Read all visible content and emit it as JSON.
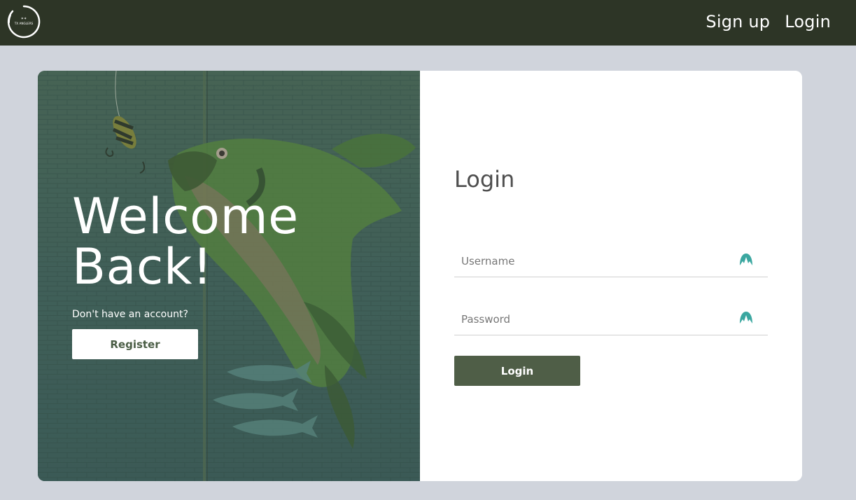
{
  "navbar": {
    "logo_icon": "anglers-logo-icon",
    "logo_text": "TX ANGLERS",
    "links": [
      {
        "label": "Sign up"
      },
      {
        "label": "Login"
      }
    ],
    "colors": {
      "background": "#2d3526",
      "text": "#ffffff"
    }
  },
  "hero": {
    "title_line1": "Welcome",
    "title_line2": "Back!",
    "subtitle": "Don't have an account?",
    "register_label": "Register",
    "background_icon": "fish-mural-image"
  },
  "form": {
    "title": "Login",
    "username": {
      "placeholder": "Username",
      "value": "",
      "icon": "user-status-icon"
    },
    "password": {
      "placeholder": "Password",
      "value": "",
      "icon": "password-status-icon"
    },
    "submit_label": "Login",
    "colors": {
      "button": "#4f5e47",
      "icon": "#3ba7a0"
    }
  },
  "colors": {
    "page_background": "#d0d4dc",
    "card_background": "#ffffff"
  }
}
